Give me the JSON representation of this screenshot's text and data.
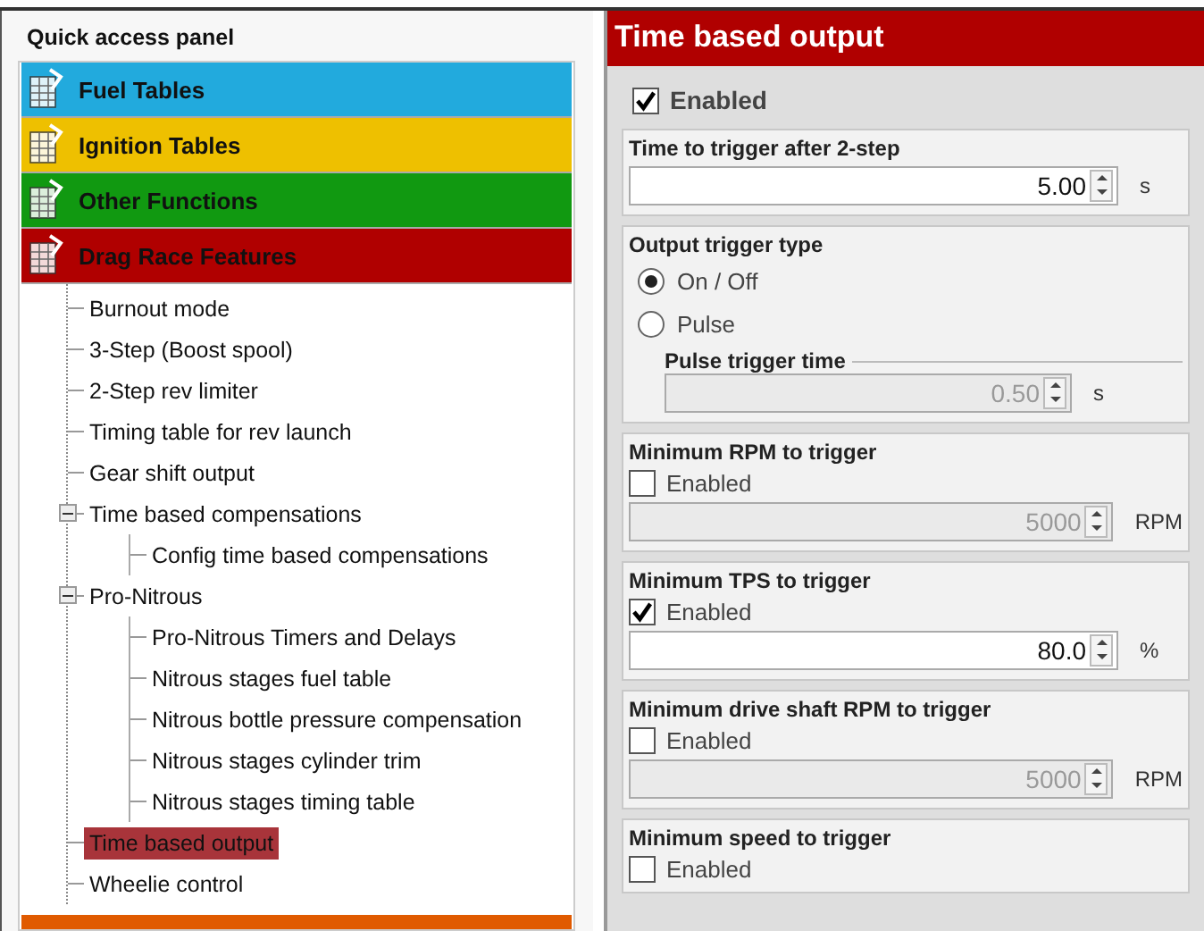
{
  "quick_access": {
    "title": "Quick access panel",
    "categories": [
      {
        "label": "Fuel Tables",
        "color": "#22aadd"
      },
      {
        "label": "Ignition Tables",
        "color": "#eec000"
      },
      {
        "label": "Other Functions",
        "color": "#119911"
      },
      {
        "label": "Drag Race Features",
        "color": "#b00000"
      }
    ],
    "tree": [
      {
        "label": "Burnout mode",
        "selected": false
      },
      {
        "label": "3-Step (Boost spool)",
        "selected": false
      },
      {
        "label": "2-Step rev limiter",
        "selected": false
      },
      {
        "label": "Timing table for rev launch",
        "selected": false
      },
      {
        "label": "Gear shift output",
        "selected": false
      },
      {
        "label": "Time based compensations",
        "selected": false,
        "expanded": true,
        "children": [
          {
            "label": "Config time based compensations",
            "selected": false
          }
        ]
      },
      {
        "label": "Pro-Nitrous",
        "selected": false,
        "expanded": true,
        "children": [
          {
            "label": "Pro-Nitrous Timers and Delays",
            "selected": false
          },
          {
            "label": "Nitrous stages fuel table",
            "selected": false
          },
          {
            "label": "Nitrous bottle pressure compensation",
            "selected": false
          },
          {
            "label": "Nitrous stages cylinder trim",
            "selected": false
          },
          {
            "label": "Nitrous stages timing table",
            "selected": false
          }
        ]
      },
      {
        "label": "Time based output",
        "selected": true
      },
      {
        "label": "Wheelie control",
        "selected": false
      }
    ],
    "next_category": {
      "color": "#e05a00"
    }
  },
  "settings": {
    "title": "Time based output",
    "enabled": {
      "label": "Enabled",
      "checked": true
    },
    "groups": [
      {
        "kind": "spin",
        "title": "Time to trigger after 2-step",
        "value": "5.00",
        "unit": "s"
      },
      {
        "kind": "radio",
        "title": "Output trigger type",
        "options": [
          {
            "label": "On / Off",
            "selected": true
          },
          {
            "label": "Pulse",
            "selected": false
          }
        ],
        "sub": {
          "title": "Pulse trigger time",
          "value": "0.50",
          "unit": "s",
          "disabled": true
        }
      },
      {
        "kind": "check_spin",
        "title": "Minimum RPM to trigger",
        "check_label": "Enabled",
        "checked": false,
        "value": "5000",
        "unit": "RPM"
      },
      {
        "kind": "check_spin",
        "title": "Minimum TPS to trigger",
        "check_label": "Enabled",
        "checked": true,
        "value": "80.0",
        "unit": "%"
      },
      {
        "kind": "check_spin",
        "title": "Minimum drive shaft RPM to trigger",
        "check_label": "Enabled",
        "checked": false,
        "value": "5000",
        "unit": "RPM"
      },
      {
        "kind": "check_only",
        "title": "Minimum speed to trigger",
        "check_label": "Enabled",
        "checked": false
      }
    ]
  }
}
